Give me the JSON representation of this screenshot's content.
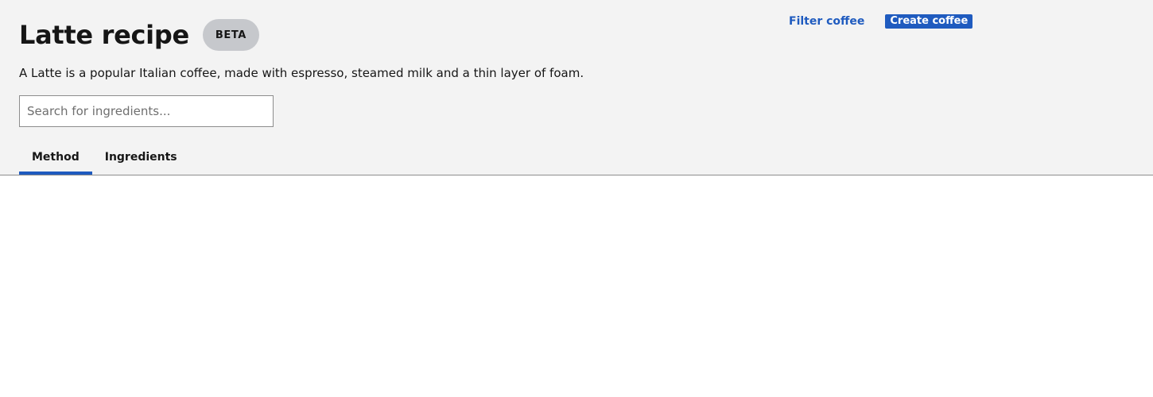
{
  "header": {
    "title": "Latte recipe",
    "badge": "BETA",
    "description": "A Latte is a popular Italian coffee, made with espresso, steamed milk and a thin layer of foam.",
    "actions": {
      "filter_label": "Filter coffee",
      "create_label": "Create coffee"
    }
  },
  "search": {
    "placeholder": "Search for ingredients...",
    "value": ""
  },
  "tabs": [
    {
      "label": "Method",
      "active": true
    },
    {
      "label": "Ingredients",
      "active": false
    }
  ],
  "colors": {
    "header_background": "#f3f3f3",
    "accent": "#1f5bbf",
    "badge_background": "#c6c8cc"
  }
}
